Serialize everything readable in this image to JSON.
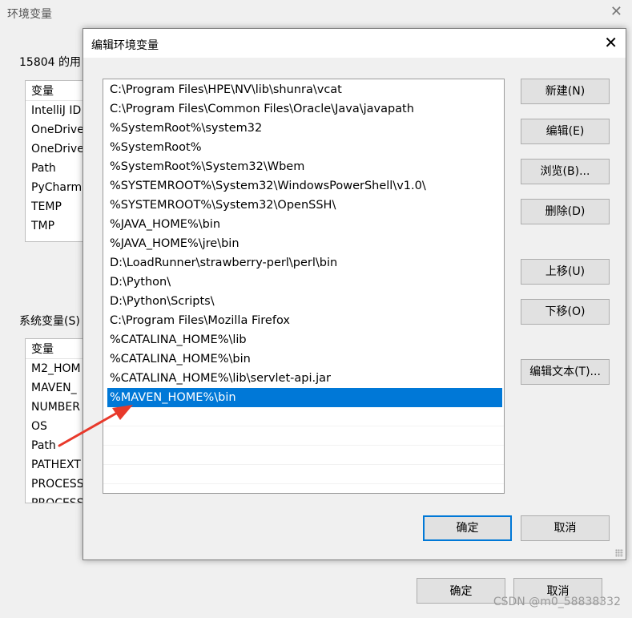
{
  "background": {
    "title": "环境变量",
    "user_group_label": "15804 的用",
    "user_vars_header": "变量",
    "user_vars": [
      "IntelliJ ID",
      "OneDrive",
      "OneDrive",
      "Path",
      "PyCharm",
      "TEMP",
      "TMP"
    ],
    "system_group_label": "系统变量(S)",
    "system_vars_header": "变量",
    "system_vars": [
      "M2_HOM",
      "MAVEN_",
      "NUMBER",
      "OS",
      "Path",
      "PATHEXT",
      "PROCESS",
      "PROCESS"
    ],
    "ok_label": "确定",
    "cancel_label": "取消"
  },
  "dialog": {
    "title": "编辑环境变量",
    "entries": [
      "C:\\Program Files\\HPE\\NV\\lib\\shunra\\vcat",
      "C:\\Program Files\\Common Files\\Oracle\\Java\\javapath",
      "%SystemRoot%\\system32",
      "%SystemRoot%",
      "%SystemRoot%\\System32\\Wbem",
      "%SYSTEMROOT%\\System32\\WindowsPowerShell\\v1.0\\",
      "%SYSTEMROOT%\\System32\\OpenSSH\\",
      "%JAVA_HOME%\\bin",
      "%JAVA_HOME%\\jre\\bin",
      "D:\\LoadRunner\\strawberry-perl\\perl\\bin",
      "D:\\Python\\",
      "D:\\Python\\Scripts\\",
      "C:\\Program Files\\Mozilla Firefox",
      "%CATALINA_HOME%\\lib",
      "%CATALINA_HOME%\\bin",
      "%CATALINA_HOME%\\lib\\servlet-api.jar",
      "%MAVEN_HOME%\\bin"
    ],
    "selected_index": 16,
    "buttons": {
      "new": "新建(N)",
      "edit": "编辑(E)",
      "browse": "浏览(B)...",
      "delete": "删除(D)",
      "move_up": "上移(U)",
      "move_down": "下移(O)",
      "edit_text": "编辑文本(T)...",
      "ok": "确定",
      "cancel": "取消"
    }
  },
  "watermark": "CSDN @m0_58838332",
  "colors": {
    "selection": "#0078d7",
    "arrow": "#e8392b"
  }
}
